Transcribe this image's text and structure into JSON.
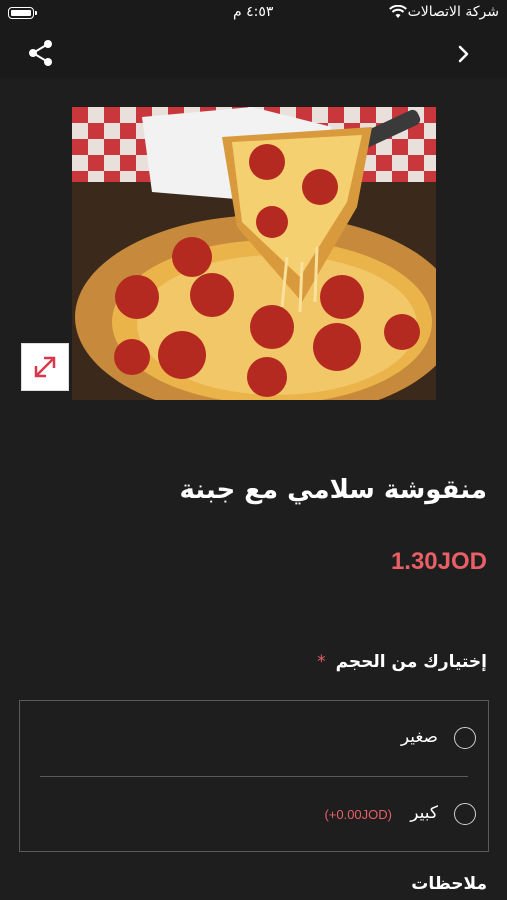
{
  "status_bar": {
    "carrier": "شركة الاتصالات",
    "time": "٤:٥٣ م"
  },
  "nav": {
    "share_icon": "share-icon",
    "back_icon": "chevron-right-icon"
  },
  "product": {
    "image_alt": "pepperoni pizza",
    "expand_icon": "expand-icon",
    "title": "منقوشة سلامي مع جبنة",
    "price": "1.30JOD"
  },
  "size_section": {
    "label": "إختيارك من الحجم",
    "required_mark": "*",
    "options": [
      {
        "name": "صغير",
        "price": ""
      },
      {
        "name": "كبير",
        "price": "(+0.00JOD)"
      }
    ]
  },
  "notes": {
    "label": "ملاحظات"
  },
  "colors": {
    "background": "#1e1e1f",
    "accent": "#e85f66"
  }
}
